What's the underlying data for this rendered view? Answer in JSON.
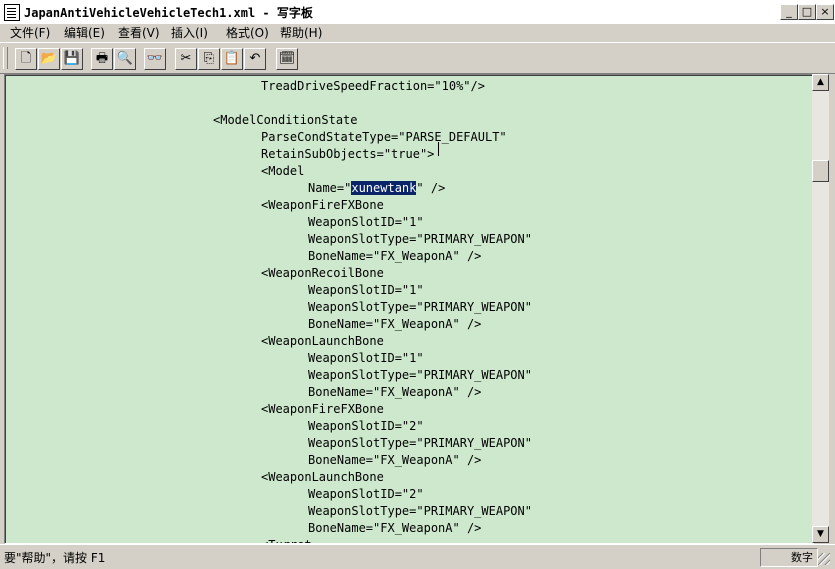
{
  "window": {
    "title": "JapanAntiVehicleVehicleTech1.xml - 写字板",
    "minimize": "_",
    "maximize": "□",
    "close": "×"
  },
  "menu": [
    "文件(F)",
    "编辑(E)",
    "查看(V)",
    "插入(I)",
    "格式(O)",
    "帮助(H)"
  ],
  "toolbar": {
    "new": "🗋",
    "open": "📂",
    "save": "💾",
    "print": "🖶",
    "preview": "🔍",
    "find": "👓",
    "cut": "✂",
    "copy": "⎘",
    "paste": "📋",
    "undo": "↶",
    "datetime": "🗓"
  },
  "editor": {
    "lines": [
      {
        "indent": 3,
        "text": "TreadDriveSpeedFraction=\"10%\"/>"
      },
      {
        "indent": 0,
        "text": ""
      },
      {
        "indent": 2,
        "text": "<ModelConditionState"
      },
      {
        "indent": 3,
        "text": "ParseCondStateType=\"PARSE_DEFAULT\""
      },
      {
        "indent": 3,
        "text": "RetainSubObjects=\"true\">"
      },
      {
        "indent": 3,
        "text": "<Model"
      },
      {
        "indent": 4,
        "pre": "Name=\"",
        "sel": "xunewtank",
        "post": "\" />"
      },
      {
        "indent": 3,
        "text": "<WeaponFireFXBone"
      },
      {
        "indent": 4,
        "text": "WeaponSlotID=\"1\""
      },
      {
        "indent": 4,
        "text": "WeaponSlotType=\"PRIMARY_WEAPON\""
      },
      {
        "indent": 4,
        "text": "BoneName=\"FX_WeaponA\" />"
      },
      {
        "indent": 3,
        "text": "<WeaponRecoilBone"
      },
      {
        "indent": 4,
        "text": "WeaponSlotID=\"1\""
      },
      {
        "indent": 4,
        "text": "WeaponSlotType=\"PRIMARY_WEAPON\""
      },
      {
        "indent": 4,
        "text": "BoneName=\"FX_WeaponA\" />"
      },
      {
        "indent": 3,
        "text": "<WeaponLaunchBone"
      },
      {
        "indent": 4,
        "text": "WeaponSlotID=\"1\""
      },
      {
        "indent": 4,
        "text": "WeaponSlotType=\"PRIMARY_WEAPON\""
      },
      {
        "indent": 4,
        "text": "BoneName=\"FX_WeaponA\" />"
      },
      {
        "indent": 3,
        "text": "<WeaponFireFXBone"
      },
      {
        "indent": 4,
        "text": "WeaponSlotID=\"2\""
      },
      {
        "indent": 4,
        "text": "WeaponSlotType=\"PRIMARY_WEAPON\""
      },
      {
        "indent": 4,
        "text": "BoneName=\"FX_WeaponA\" />"
      },
      {
        "indent": 3,
        "text": "<WeaponLaunchBone"
      },
      {
        "indent": 4,
        "text": "WeaponSlotID=\"2\""
      },
      {
        "indent": 4,
        "text": "WeaponSlotType=\"PRIMARY_WEAPON\""
      },
      {
        "indent": 4,
        "text": "BoneName=\"FX_WeaponA\" />"
      },
      {
        "indent": 3,
        "text": "<Turret"
      }
    ]
  },
  "scrollbar": {
    "up": "▲",
    "down": "▼"
  },
  "status": {
    "help_text": "要\"帮助\"，请按 F1",
    "cell": "数字"
  }
}
